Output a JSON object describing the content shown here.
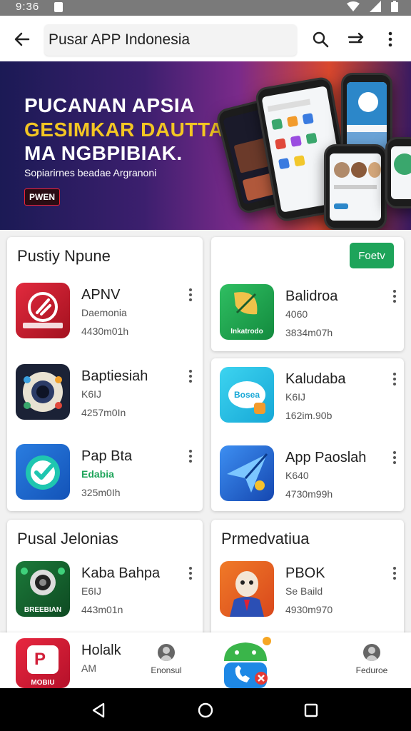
{
  "status_bar": {
    "time": "9:36"
  },
  "search": {
    "value": "Pusar APP Indonesia"
  },
  "banner": {
    "line1": "PUCANAN APSIA",
    "line2": "GESIMKAR DAUTTAL",
    "line3": "MA NGBPIBIAK.",
    "subtitle": "Sopiarirnes beadae Argranoni",
    "button": "PWEN"
  },
  "sections": [
    {
      "title": "Pustiy Npune",
      "apps": [
        {
          "name": "APNV",
          "sub": "Daemonia",
          "meta": "4430m01h",
          "icon": "rocket-app-icon"
        },
        {
          "name": "Baptiesiah",
          "sub": "K6IJ",
          "meta": "4257m0In",
          "icon": "camera-lens-app-icon"
        },
        {
          "name": "Pap Bta",
          "sub": "Edabia",
          "meta": "325m0Ih",
          "icon": "checkmark-app-icon"
        }
      ]
    },
    {
      "chip": "Foetv",
      "apps": [
        {
          "name": "Balidroa",
          "sub": "4060",
          "meta": "3834m07h",
          "icon": "leaf-app-icon",
          "label": "Inkatrodo"
        },
        {
          "name": "Kaludaba",
          "sub": "K6IJ",
          "meta": "162im.90b",
          "icon": "bosea-app-icon",
          "label": "Bosea"
        },
        {
          "name": "App Paoslah",
          "sub": "K640",
          "meta": "4730m99h",
          "icon": "paper-plane-app-icon"
        }
      ]
    },
    {
      "title": "Pusal Jelonias",
      "apps": [
        {
          "name": "Kaba Bahpa",
          "sub": "E6IJ",
          "meta": "443m01n",
          "icon": "camera-app-icon",
          "label": "BREEBIAN"
        },
        {
          "name": "Holalk",
          "sub": "AM",
          "icon": "book-app-icon",
          "label": "MOBIU"
        }
      ]
    },
    {
      "title": "Prmedvatiua",
      "apps": [
        {
          "name": "PBOK",
          "sub": "Se Baild",
          "meta": "4930m970",
          "icon": "cartoon-app-icon"
        }
      ]
    }
  ],
  "bottom_nav": {
    "left_label": "Enonsul",
    "right_label": "Feduroe"
  },
  "colors": {
    "accent_green": "#1ea45a",
    "banner_yellow": "#f3c623"
  }
}
